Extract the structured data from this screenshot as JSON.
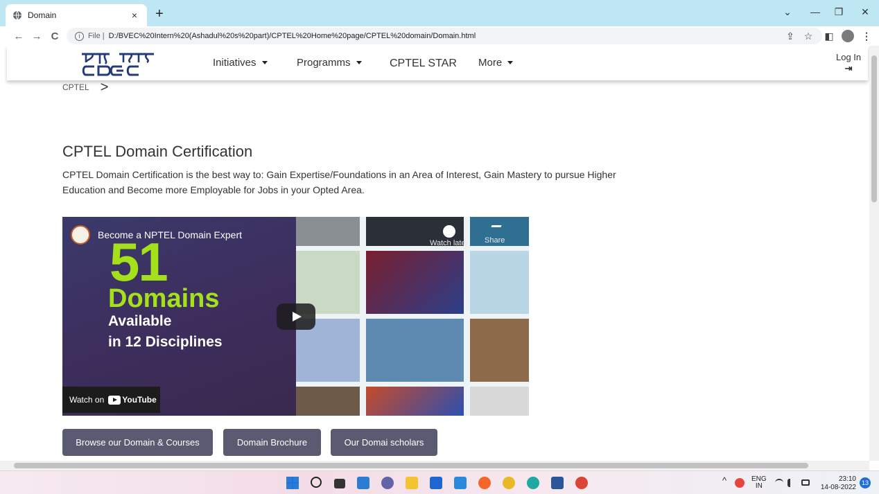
{
  "browser": {
    "tab_title": "Domain",
    "tab_close": "×",
    "new_tab": "+",
    "controls": {
      "dropdown": "⌄",
      "minimize": "—",
      "maximize": "❐",
      "close": "✕"
    },
    "nav": {
      "back": "←",
      "forward": "→",
      "reload": "C"
    },
    "info": "i",
    "file_label": "File |",
    "url": "D:/BVEC%20Intern%20(Ashadul%20s%20part)/CPTEL%20Home%20page/CPTEL%20domain/Domain.html",
    "right_icons": {
      "share": "⇪",
      "star": "☆",
      "panel": "◧",
      "menu": "⋮"
    }
  },
  "site_nav": {
    "logo": "सी-डैक CDAC",
    "items": [
      {
        "label": "Initiatives",
        "dropdown": true
      },
      {
        "label": "Programms",
        "dropdown": true
      },
      {
        "label": "CPTEL STAR",
        "dropdown": false
      },
      {
        "label": "More",
        "dropdown": true
      }
    ],
    "login_label": "Log In",
    "login_icon": "⇥"
  },
  "breadcrumb": {
    "item": "CPTEL",
    "separator": ">"
  },
  "content": {
    "heading": "CPTEL Domain Certification",
    "description": "CPTEL Domain Certification is the best way to: Gain Expertise/Foundations in an Area of Interest, Gain Mastery to pursue Higher Education and Become more Employable for Jobs in your Opted Area."
  },
  "video": {
    "title": "Become a NPTEL Domain Expert",
    "big_number": "51",
    "big_word": "Domains",
    "line1": "Available",
    "line2": "in 12 Disciplines",
    "watch_on": "Watch on",
    "youtube_label": "YouTube",
    "watch_later": "Watch later",
    "share": "Share"
  },
  "buttons": [
    {
      "label": "Browse our Domain & Courses"
    },
    {
      "label": "Domain Brochure"
    },
    {
      "label": "Our Domai scholars"
    }
  ],
  "taskbar": {
    "lang_top": "ENG",
    "lang_bottom": "IN",
    "tray_chevron": "^",
    "time": "23:10",
    "date": "14-08-2022",
    "notifications": "13"
  },
  "colors": {
    "tab_strip": "#bfe6f3",
    "button_bg": "#5a5a72",
    "video_accent": "#a5e11a",
    "video_bg": "#3b3360"
  }
}
